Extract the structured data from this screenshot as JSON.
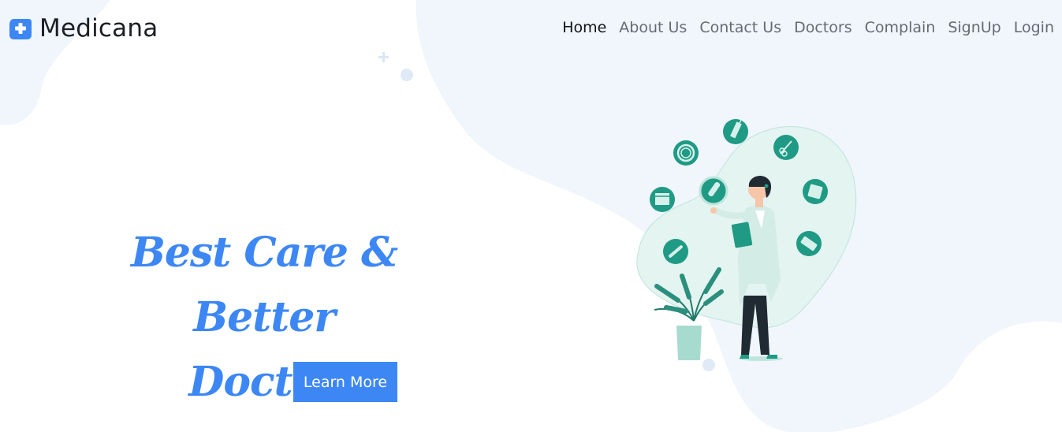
{
  "brand": {
    "name": "Medicana",
    "icon": "medical-cross-icon"
  },
  "nav": {
    "items": [
      {
        "label": "Home",
        "active": true
      },
      {
        "label": "About Us"
      },
      {
        "label": "Contact Us"
      },
      {
        "label": "Doctors"
      },
      {
        "label": "Complain"
      },
      {
        "label": "SignUp"
      },
      {
        "label": "Login"
      }
    ]
  },
  "hero": {
    "title_line1": "Best Care &",
    "title_line2": "Better Doctor",
    "cta_label": "Learn More"
  },
  "colors": {
    "accent": "#3d87f5",
    "teal": "#1f9a85",
    "blob_bg": "#f0f6fc"
  },
  "illustration": {
    "icons": [
      "syringe-icon",
      "scissors-icon",
      "stethoscope-icon",
      "bandage-icon",
      "calendar-icon",
      "pills-icon",
      "thermometer-icon",
      "capsule-icon"
    ]
  }
}
